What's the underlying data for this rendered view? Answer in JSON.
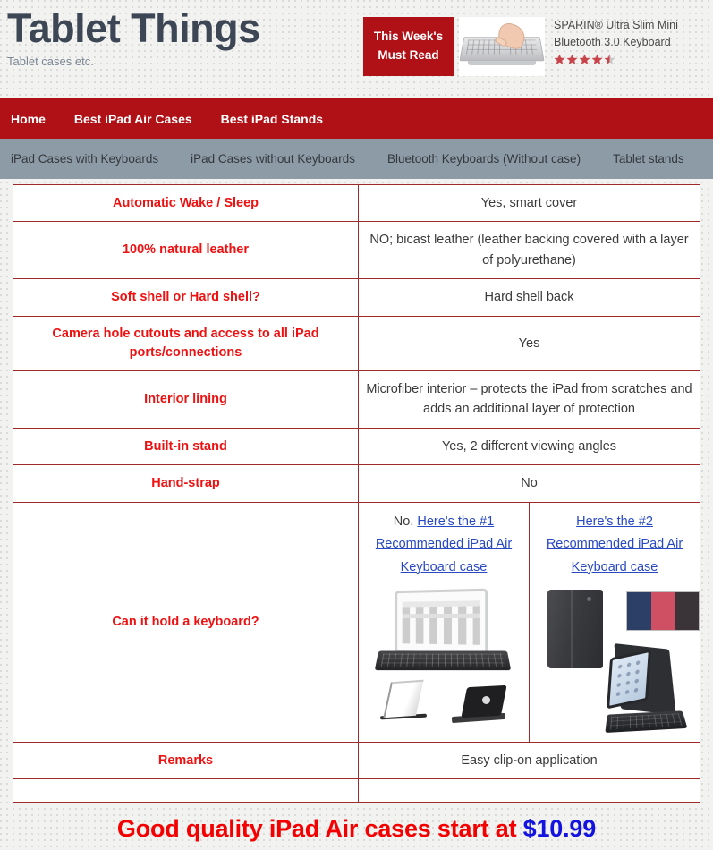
{
  "header": {
    "site_title": "Tablet Things",
    "tagline": "Tablet cases etc.",
    "promo": {
      "badge_line1": "This Week's",
      "badge_line2": "Must Read",
      "product_title": "SPARIN® Ultra Slim Mini Bluetooth 3.0 Keyboard",
      "rating": 4.5,
      "rating_max": 5,
      "star_color": "#c9444a",
      "star_empty_color": "#c9c9c9",
      "thumb_alt": "hand-typing-on-bluetooth-keyboard"
    }
  },
  "nav_main": {
    "items": [
      {
        "label": "Home"
      },
      {
        "label": "Best iPad Air Cases"
      },
      {
        "label": "Best iPad Stands"
      }
    ]
  },
  "nav_sub": {
    "items": [
      {
        "label": "iPad Cases with Keyboards"
      },
      {
        "label": "iPad Cases without Keyboards"
      },
      {
        "label": "Bluetooth Keyboards (Without case)"
      },
      {
        "label": "Tablet stands"
      }
    ]
  },
  "spec_table": {
    "border_color": "#9e2a2a",
    "label_color": "#ee1111",
    "rows": [
      {
        "label": "Automatic Wake / Sleep",
        "value": "Yes, smart cover"
      },
      {
        "label": "100% natural leather",
        "value": "NO; bicast leather (leather backing covered with a layer of polyurethane)"
      },
      {
        "label": "Soft shell or Hard shell?",
        "value": "Hard shell back"
      },
      {
        "label": "Camera hole cutouts and access to all iPad ports/connections",
        "value": "Yes"
      },
      {
        "label": "Interior lining",
        "value": "Microfiber interior – protects the iPad from scratches and adds an additional layer of protection"
      },
      {
        "label": "Built-in stand",
        "value": "Yes, 2 different viewing angles"
      },
      {
        "label": "Hand-strap",
        "value": "No"
      }
    ],
    "keyboard_row": {
      "label": "Can it hold a keyboard?",
      "col1_prefix": "No. ",
      "col1_link": "Here's the #1 Recommended iPad Air Keyboard case",
      "col1_image_alt": "ipad-air-bluetooth-keyboard-case-product-photo",
      "col2_link": "Here's the #2 Recommended iPad Air Keyboard case",
      "col2_image_alt": "black-folio-keyboard-case-with-color-swatches-product-photo",
      "link_color": "#2949c4"
    },
    "remarks_row": {
      "label": "Remarks",
      "value": "Easy clip-on application"
    }
  },
  "footer": {
    "headline_text": "Good quality iPad Air cases start at ",
    "headline_price": "$10.99",
    "text_color": "#f40000",
    "price_color": "#1313e0"
  }
}
